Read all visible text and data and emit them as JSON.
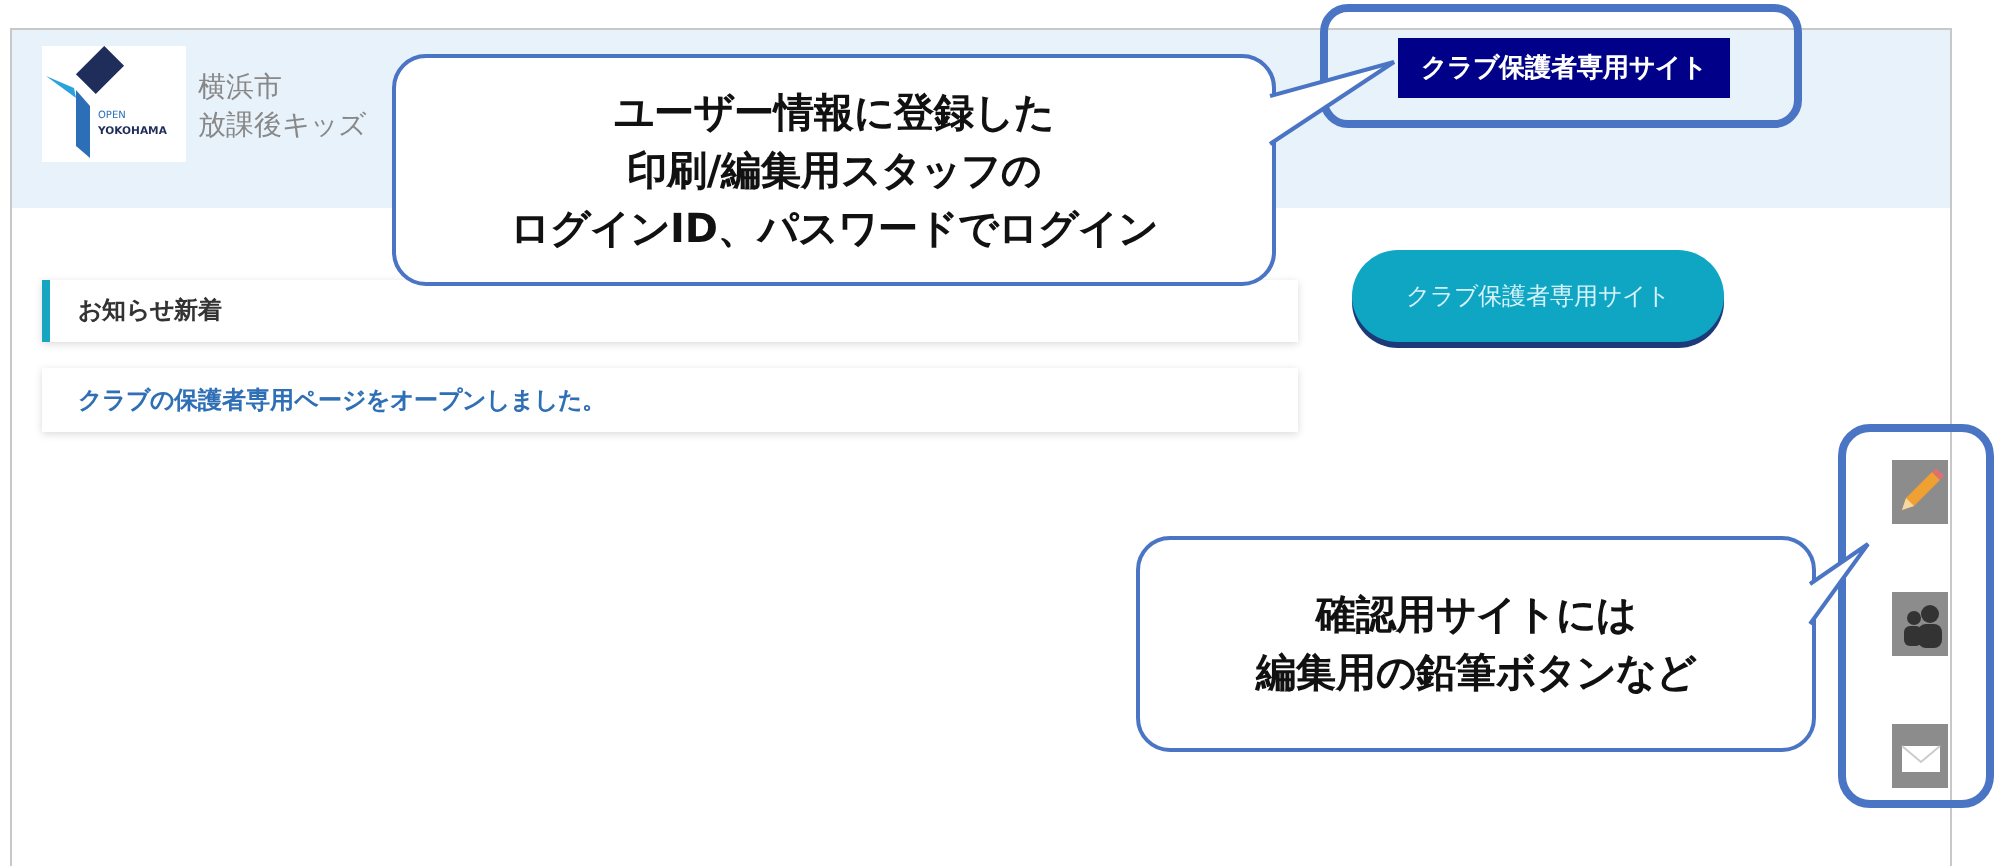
{
  "header": {
    "logo": {
      "line_1": "OPEN",
      "line_2": "YOKOHAMA"
    },
    "title_lines": [
      "横浜市",
      "放課後キッズ"
    ],
    "site_button": "クラブ保護者専用サイト"
  },
  "main_button": "クラブ保護者専用サイト",
  "news": {
    "title": "お知らせ新着",
    "items": [
      "クラブの保護者専用ページをオープンしました。"
    ]
  },
  "side_tools": [
    {
      "kind": "pencil"
    },
    {
      "kind": "people"
    },
    {
      "kind": "mail"
    }
  ],
  "annotations": [
    {
      "lines": [
        "ユーザー情報に登録した",
        "印刷/編集用スタッフの",
        "ログインID、パスワードでログイン"
      ]
    },
    {
      "lines": [
        "確認用サイトには",
        "編集用の鉛筆ボタンなど"
      ]
    }
  ]
}
